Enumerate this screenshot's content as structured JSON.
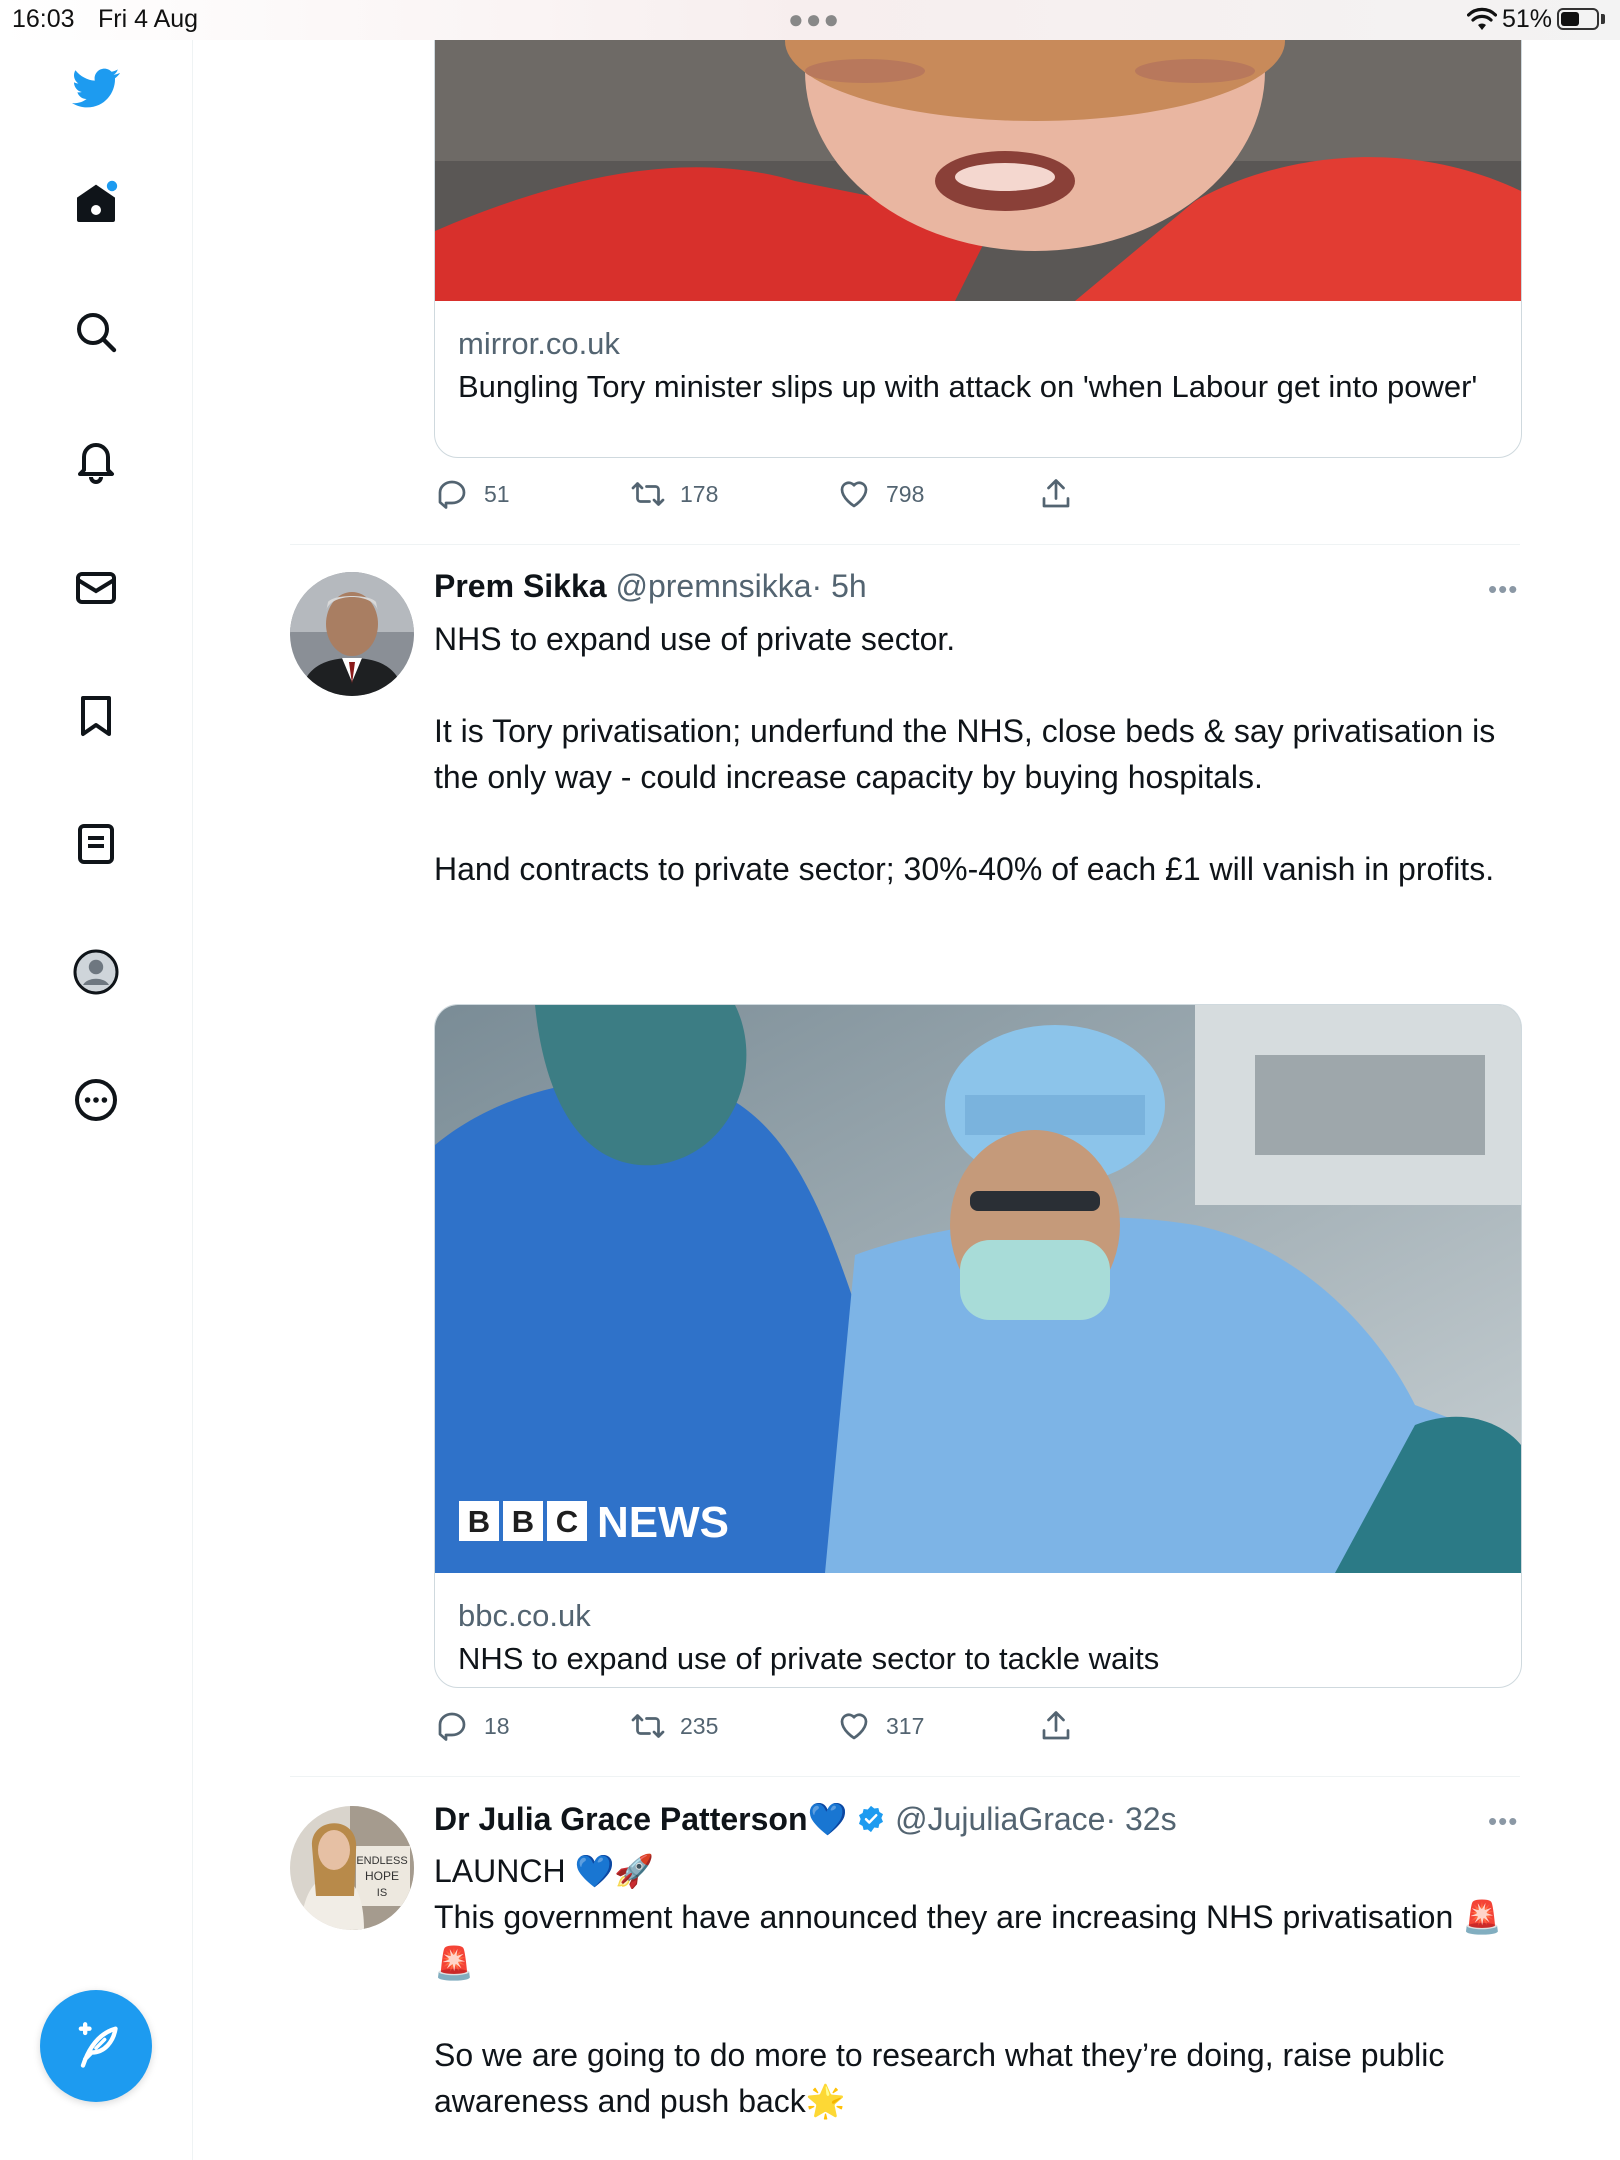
{
  "status_bar": {
    "time": "16:03",
    "date": "Fri 4 Aug",
    "battery": "51%"
  },
  "colors": {
    "accent": "#1d9bf0",
    "secondary_text": "#536471",
    "border": "#cfd9de"
  },
  "sidebar": {
    "items": [
      {
        "icon": "twitter-bird-icon"
      },
      {
        "icon": "home-icon"
      },
      {
        "icon": "search-icon"
      },
      {
        "icon": "bell-icon"
      },
      {
        "icon": "mail-icon"
      },
      {
        "icon": "bookmark-icon"
      },
      {
        "icon": "list-icon"
      },
      {
        "icon": "profile-icon"
      },
      {
        "icon": "more-circle-icon"
      }
    ],
    "compose_icon": "feather-plus-icon"
  },
  "tweets": [
    {
      "card": {
        "domain": "mirror.co.uk",
        "title": "Bungling Tory minister slips up with attack on 'when Labour get into power'"
      },
      "actions": {
        "replies": "51",
        "retweets": "178",
        "likes": "798"
      }
    },
    {
      "name": "Prem Sikka",
      "handle": "@premnsikka",
      "time": "· 5h",
      "text": [
        "NHS to expand use of private sector.",
        "It is Tory privatisation; underfund the NHS, close beds & say privatisation is the only way - could increase capacity by buying hospitals.",
        "Hand contracts to private sector; 30%-40% of each £1 will vanish in profits."
      ],
      "card": {
        "image_brand": "NEWS",
        "image_brand_blocks": [
          "B",
          "B",
          "C"
        ],
        "domain": "bbc.co.uk",
        "title": "NHS to expand use of private sector to tackle waits"
      },
      "actions": {
        "replies": "18",
        "retweets": "235",
        "likes": "317"
      }
    },
    {
      "name": "Dr Julia Grace Patterson",
      "name_emoji": "💙",
      "handle": "@JujuliaGrace",
      "time": "· 32s",
      "text": [
        "LAUNCH 💙🚀",
        "This government have announced they are increasing NHS privatisation 🚨🚨",
        "So we are going to do more to research what they’re doing, raise public awareness and push back🌟"
      ]
    }
  ]
}
